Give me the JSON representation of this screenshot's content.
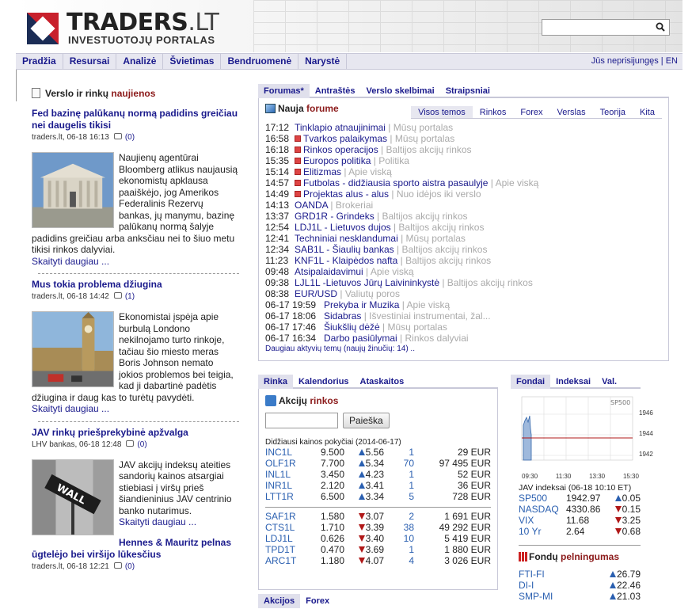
{
  "header": {
    "logo_main": "TRADERS",
    "logo_suffix": ".LT",
    "logo_sub": "INVESTUOTOJŲ PORTALAS",
    "search_placeholder": ""
  },
  "nav": {
    "items": [
      "Pradžia",
      "Resursai",
      "Analizė",
      "Švietimas",
      "Bendruomenė",
      "Narystė"
    ],
    "login": "Jūs neprisijungęs | EN"
  },
  "left": {
    "title_pre": "Verslo ir rinkų",
    "title_hl": "naujienos",
    "articles": [
      {
        "title": "Fed bazinę palūkanų normą padidins greičiau nei daugelis tikisi",
        "meta": "traders.lt, 06-18 16:13",
        "comments": "(0)",
        "body": "Naujienų agentūrai Bloomberg atlikus naujausią ekonomistų apklausa paaiškėjo, jog Amerikos Federalinis Rezervų bankas, jų manymu, bazinę palūkanų normą šalyje padidins greičiau arba anksčiau nei to šiuo metu tikisi rinkos dalyviai.",
        "more": "Skaityti daugiau ..."
      },
      {
        "title": "Mus tokia problema džiugina",
        "meta": "traders.lt, 06-18 14:42",
        "comments": "(1)",
        "body": "Ekonomistai įspėja apie burbulą Londono nekilnojamo turto rinkoje, tačiau šio miesto meras Boris Johnson nemato jokios problemos bei teigia, kad ji dabartinė padėtis džiugina ir daug kas to turėtų pavydėti.",
        "more": "Skaityti daugiau ..."
      },
      {
        "title": "JAV rinkų priešprekybinė apžvalga",
        "meta": "LHV bankas, 06-18 12:48",
        "comments": "(0)",
        "body": "JAV akcijų indeksų ateities sandorių kainos atsargiai stiebiasi į viršų prieš šiandieninius JAV centrinio banko nutarimus.",
        "more": "Skaityti daugiau ..."
      },
      {
        "title": "Hennes & Mauritz pelnas ūgtelėjo bei viršijo lūkesčius",
        "meta": "traders.lt, 06-18 12:21",
        "comments": "(0)"
      }
    ]
  },
  "forum": {
    "tabs": [
      "Forumas*",
      "Antraštės",
      "Verslo skelbimai",
      "Straipsniai"
    ],
    "title_pre": "Nauja",
    "title_hl": "forume",
    "subtabs": [
      "Visos temos",
      "Rinkos",
      "Forex",
      "Verslas",
      "Teorija",
      "Kita"
    ],
    "rows": [
      {
        "time": "17:12",
        "icon": false,
        "topic": "Tinklapio atnaujinimai",
        "cat": "Mūsų portalas"
      },
      {
        "time": "16:58",
        "icon": true,
        "topic": "Tvarkos palaikymas",
        "cat": "Mūsų portalas"
      },
      {
        "time": "16:18",
        "icon": true,
        "topic": "Rinkos operacijos",
        "cat": "Baltijos akcijų rinkos"
      },
      {
        "time": "15:35",
        "icon": true,
        "topic": "Europos politika",
        "cat": "Politika"
      },
      {
        "time": "15:14",
        "icon": true,
        "topic": "Elitizmas",
        "cat": "Apie viską"
      },
      {
        "time": "14:57",
        "icon": true,
        "topic": "Futbolas - didžiausia sporto aistra pasaulyje",
        "cat": "Apie viską"
      },
      {
        "time": "14:49",
        "icon": true,
        "topic": "Projektas alus - alus",
        "cat": "Nuo idėjos iki verslo"
      },
      {
        "time": "14:13",
        "icon": false,
        "topic": "OANDA",
        "cat": "Brokeriai"
      },
      {
        "time": "13:37",
        "icon": false,
        "topic": "GRD1R - Grindeks",
        "cat": "Baltijos akcijų rinkos"
      },
      {
        "time": "12:54",
        "icon": false,
        "topic": "LDJ1L - Lietuvos dujos",
        "cat": "Baltijos akcijų rinkos"
      },
      {
        "time": "12:41",
        "icon": false,
        "topic": "Techniniai nesklandumai",
        "cat": "Mūsų portalas"
      },
      {
        "time": "12:34",
        "icon": false,
        "topic": "SAB1L - Šiaulių bankas",
        "cat": "Baltijos akcijų rinkos"
      },
      {
        "time": "11:23",
        "icon": false,
        "topic": "KNF1L - Klaipėdos nafta",
        "cat": "Baltijos akcijų rinkos"
      },
      {
        "time": "09:48",
        "icon": false,
        "topic": "Atsipalaidavimui",
        "cat": "Apie viską"
      },
      {
        "time": "09:38",
        "icon": false,
        "topic": "LJL1L -Lietuvos Jūrų Laivininkystė",
        "cat": "Baltijos akcijų rinkos"
      },
      {
        "time": "08:38",
        "icon": false,
        "topic": "EUR/USD",
        "cat": "Valiutų poros"
      },
      {
        "time": "06-17 19:59",
        "icon": false,
        "topic": "Prekyba ir Muzika",
        "cat": "Apie viską"
      },
      {
        "time": "06-17 18:06",
        "icon": false,
        "topic": "Sidabras",
        "cat": "Išvestiniai instrumentai, žal..."
      },
      {
        "time": "06-17 17:46",
        "icon": false,
        "topic": "Šiukšlių dėžė",
        "cat": "Mūsų portalas"
      },
      {
        "time": "06-17 16:34",
        "icon": false,
        "topic": "Darbo pasiūlymai",
        "cat": "Rinkos dalyviai"
      }
    ],
    "more": "Daugiau aktyvių temų (naujų žinučių: 14) .."
  },
  "market": {
    "tabs": [
      "Rinka",
      "Kalendorius",
      "Ataskaitos"
    ],
    "title_pre": "Akcijų",
    "title_hl": "rinkos",
    "search_btn": "Paieška",
    "caption": "Didžiausi kainos pokyčiai (2014-06-17)",
    "gainers": [
      {
        "sym": "INC1L",
        "price": "9.500",
        "chg": "5.56",
        "vol": "1",
        "eur": "29 EUR"
      },
      {
        "sym": "OLF1R",
        "price": "7.700",
        "chg": "5.34",
        "vol": "70",
        "eur": "97 495 EUR"
      },
      {
        "sym": "INL1L",
        "price": "3.450",
        "chg": "4.23",
        "vol": "1",
        "eur": "52 EUR"
      },
      {
        "sym": "INR1L",
        "price": "2.120",
        "chg": "3.41",
        "vol": "1",
        "eur": "36 EUR"
      },
      {
        "sym": "LTT1R",
        "price": "6.500",
        "chg": "3.34",
        "vol": "5",
        "eur": "728 EUR"
      }
    ],
    "losers": [
      {
        "sym": "SAF1R",
        "price": "1.580",
        "chg": "3.07",
        "vol": "2",
        "eur": "1 691 EUR"
      },
      {
        "sym": "CTS1L",
        "price": "1.710",
        "chg": "3.39",
        "vol": "38",
        "eur": "49 292 EUR"
      },
      {
        "sym": "LDJ1L",
        "price": "0.626",
        "chg": "3.40",
        "vol": "10",
        "eur": "5 419 EUR"
      },
      {
        "sym": "TPD1T",
        "price": "0.470",
        "chg": "3.69",
        "vol": "1",
        "eur": "1 880 EUR"
      },
      {
        "sym": "ARC1T",
        "price": "1.180",
        "chg": "4.07",
        "vol": "4",
        "eur": "3 026 EUR"
      }
    ],
    "bottom_tabs": [
      "Akcijos",
      "Forex"
    ]
  },
  "funds": {
    "tabs": [
      "Fondai",
      "Indeksai",
      "Val."
    ],
    "chart": {
      "label": "SP500",
      "y_ticks": [
        "1946",
        "1944",
        "1942"
      ],
      "x_ticks": [
        "09:30",
        "11:30",
        "13:30",
        "15:30"
      ]
    },
    "indices_caption": "JAV indeksai (06-18 10:10 ET)",
    "indices": [
      {
        "name": "SP500",
        "value": "1942.97",
        "chg": "0.05",
        "dir": "up"
      },
      {
        "name": "NASDAQ",
        "value": "4330.86",
        "chg": "0.15",
        "dir": "dn"
      },
      {
        "name": "VIX",
        "value": "11.68",
        "chg": "3.25",
        "dir": "dn"
      },
      {
        "name": "10 Yr",
        "value": "2.64",
        "chg": "0.68",
        "dir": "dn"
      }
    ],
    "fund_title_pre": "Fondų",
    "fund_title_hl": "pelningumas",
    "fund_rows": [
      {
        "name": "FTI-FI",
        "chg": "26.79",
        "dir": "up"
      },
      {
        "name": "DI-I",
        "chg": "22.46",
        "dir": "up"
      },
      {
        "name": "SMP-MI",
        "chg": "21.03",
        "dir": "up"
      }
    ]
  },
  "colors": {
    "link": "#1a1a8c",
    "accent": "#8b1a1a",
    "up": "#2a5fb0",
    "down": "#b01818"
  }
}
